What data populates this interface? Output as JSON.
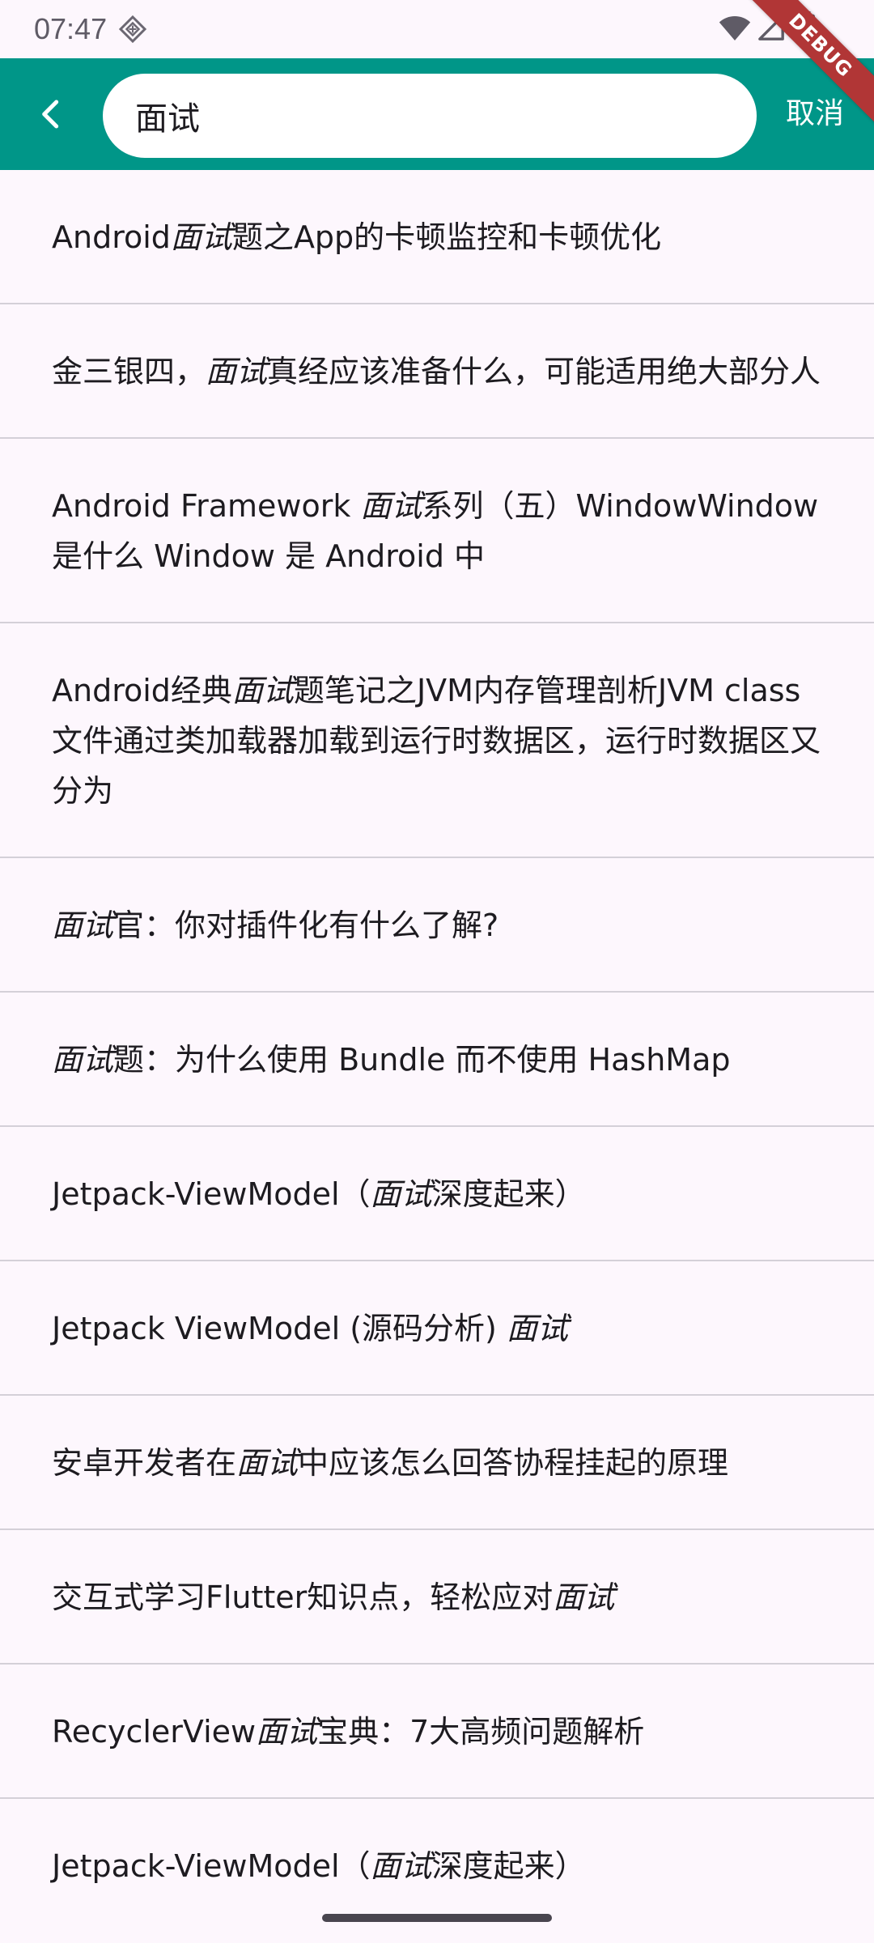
{
  "status_bar": {
    "time": "07:47"
  },
  "debug_banner": {
    "label": "DEBUG"
  },
  "app_bar": {
    "search_value": "面试",
    "cancel_label": "取消",
    "color": "#009688"
  },
  "highlight_term": "面试",
  "results": [
    "Android面试题之App的卡顿监控和卡顿优化",
    "金三银四，面试真经应该准备什么，可能适用绝大部分人",
    "Android Framework 面试系列（五）WindowWindow 是什么 Window 是 Android 中",
    "Android经典面试题笔记之JVM内存管理剖析JVM class文件通过类加载器加载到运行时数据区，运行时数据区又分为",
    "面试官：你对插件化有什么了解?",
    "面试题：为什么使用 Bundle 而不使用 HashMap",
    "Jetpack-ViewModel（面试深度起来）",
    "Jetpack ViewModel (源码分析) 面试",
    "安卓开发者在面试中应该怎么回答协程挂起的原理",
    "交互式学习Flutter知识点，轻松应对面试",
    "RecyclerView面试宝典：7大高频问题解析",
    "Jetpack-ViewModel（面试深度起来）"
  ]
}
